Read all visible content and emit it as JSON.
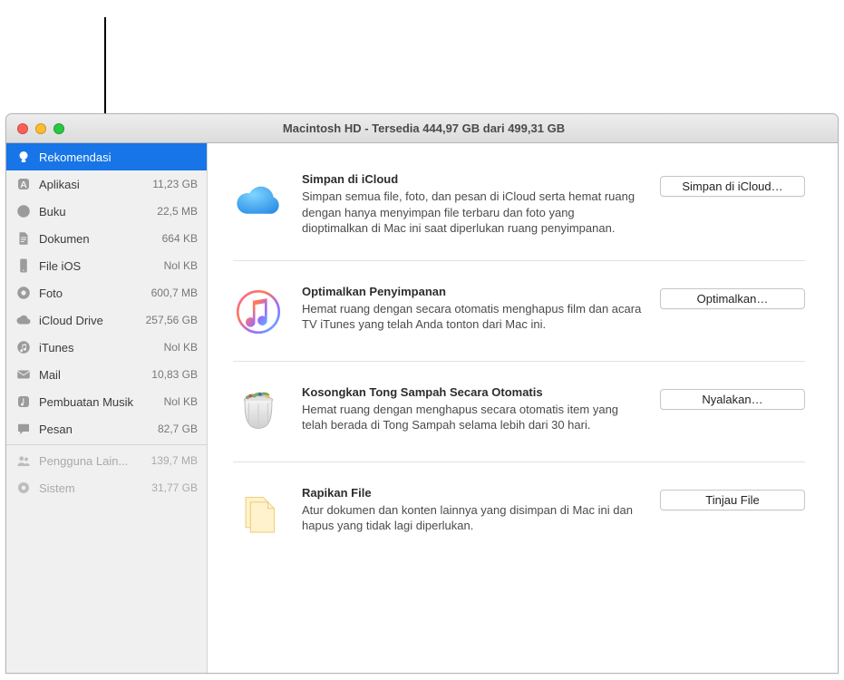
{
  "window": {
    "title": "Macintosh HD - Tersedia 444,97 GB dari 499,31 GB"
  },
  "sidebar": {
    "items": [
      {
        "label": "Rekomendasi",
        "size": "",
        "selected": true,
        "dim": false,
        "icon": "lightbulb"
      },
      {
        "label": "Aplikasi",
        "size": "11,23 GB",
        "selected": false,
        "dim": false,
        "icon": "app"
      },
      {
        "label": "Buku",
        "size": "22,5 MB",
        "selected": false,
        "dim": false,
        "icon": "book"
      },
      {
        "label": "Dokumen",
        "size": "664 KB",
        "selected": false,
        "dim": false,
        "icon": "doc"
      },
      {
        "label": "File iOS",
        "size": "Nol KB",
        "selected": false,
        "dim": false,
        "icon": "phone"
      },
      {
        "label": "Foto",
        "size": "600,7 MB",
        "selected": false,
        "dim": false,
        "icon": "photo"
      },
      {
        "label": "iCloud Drive",
        "size": "257,56 GB",
        "selected": false,
        "dim": false,
        "icon": "cloud"
      },
      {
        "label": "iTunes",
        "size": "Nol KB",
        "selected": false,
        "dim": false,
        "icon": "itunes"
      },
      {
        "label": "Mail",
        "size": "10,83 GB",
        "selected": false,
        "dim": false,
        "icon": "mail"
      },
      {
        "label": "Pembuatan Musik",
        "size": "Nol KB",
        "selected": false,
        "dim": false,
        "icon": "music"
      },
      {
        "label": "Pesan",
        "size": "82,7 GB",
        "selected": false,
        "dim": false,
        "icon": "chat"
      },
      {
        "label": "Pengguna Lain...",
        "size": "139,7 MB",
        "selected": false,
        "dim": true,
        "icon": "users"
      },
      {
        "label": "Sistem",
        "size": "31,77 GB",
        "selected": false,
        "dim": true,
        "icon": "gear"
      }
    ]
  },
  "recommendations": [
    {
      "title": "Simpan di iCloud",
      "desc": "Simpan semua file, foto, dan pesan di iCloud serta hemat ruang dengan hanya menyimpan file terbaru dan foto yang dioptimalkan di Mac ini saat diperlukan ruang penyimpanan.",
      "button": "Simpan di iCloud…",
      "icon": "icloud"
    },
    {
      "title": "Optimalkan Penyimpanan",
      "desc": "Hemat ruang dengan secara otomatis menghapus film dan acara TV iTunes yang telah Anda tonton dari Mac ini.",
      "button": "Optimalkan…",
      "icon": "itunes-color"
    },
    {
      "title": "Kosongkan Tong Sampah Secara Otomatis",
      "desc": "Hemat ruang dengan menghapus secara otomatis item yang telah berada di Tong Sampah selama lebih dari 30 hari.",
      "button": "Nyalakan…",
      "icon": "trash"
    },
    {
      "title": "Rapikan File",
      "desc": "Atur dokumen dan konten lainnya yang disimpan di Mac ini dan hapus yang tidak lagi diperlukan.",
      "button": "Tinjau File",
      "icon": "files"
    }
  ]
}
